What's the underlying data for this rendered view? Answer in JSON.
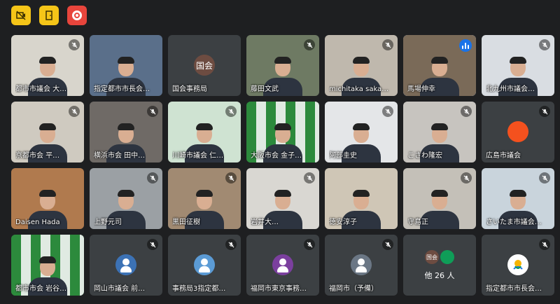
{
  "toolbar": {
    "buttons": [
      {
        "icon": "camera-off-icon",
        "style": "yellow"
      },
      {
        "icon": "door-exit-icon",
        "style": "yellow"
      },
      {
        "icon": "record-icon",
        "style": "red"
      }
    ]
  },
  "colors": {
    "background": "#1e1f21",
    "tile": "#3c4043",
    "active_outline": "#8ab4f8",
    "speaking": "#1a73e8",
    "yellow": "#f5c518",
    "red": "#e8453c"
  },
  "participants": [
    {
      "name": "都市市議会 大…",
      "kind": "video",
      "muted": true,
      "bg": "#d8d5cc"
    },
    {
      "name": "指定都市市長会…",
      "kind": "video",
      "muted": false,
      "bg": "#5a6f8a"
    },
    {
      "name": "国会事務局",
      "kind": "avatar",
      "muted": false,
      "initial": "国会",
      "avatar_color": "#6d4c41"
    },
    {
      "name": "藤田文武",
      "kind": "video",
      "muted": true,
      "bg": "#6e7a63"
    },
    {
      "name": "michitaka saka…",
      "kind": "video",
      "muted": true,
      "bg": "#bfb8ad"
    },
    {
      "name": "馬場伸幸",
      "kind": "video",
      "muted": false,
      "speaking": true,
      "active": true,
      "bg": "#7a6a58"
    },
    {
      "name": "北九州市議会…",
      "kind": "video",
      "muted": true,
      "bg": "#d9dde2"
    },
    {
      "name": "京都市会 平…",
      "kind": "video",
      "muted": true,
      "bg": "#cfcac0"
    },
    {
      "name": "横浜市会 田中…",
      "kind": "video",
      "muted": true,
      "bg": "#6f6a66"
    },
    {
      "name": "川崎市議会 仁…",
      "kind": "video",
      "muted": true,
      "bg": "#cfe3d2"
    },
    {
      "name": "大阪市会 金子…",
      "kind": "video",
      "muted": false,
      "bg": "#2d8a3c",
      "mosaic": true
    },
    {
      "name": "阿部圭史",
      "kind": "video",
      "muted": true,
      "bg": "#e4e6e8"
    },
    {
      "name": "こさわ隆宏",
      "kind": "video",
      "muted": true,
      "bg": "#c7c4bf"
    },
    {
      "name": "広島市議会",
      "kind": "avatar",
      "muted": true,
      "initial": "",
      "avatar_color": "#f4511e"
    },
    {
      "name": "Daisen Hada",
      "kind": "video",
      "muted": false,
      "bg": "#b07a4e"
    },
    {
      "name": "上野元司",
      "kind": "video",
      "muted": true,
      "bg": "#9ba0a4"
    },
    {
      "name": "黒田征樹",
      "kind": "video",
      "muted": true,
      "bg": "#a18a72"
    },
    {
      "name": "岩井大…",
      "kind": "video",
      "muted": true,
      "bg": "#d9d7d2"
    },
    {
      "name": "徳安淳子",
      "kind": "video",
      "muted": false,
      "bg": "#cfc6b6"
    },
    {
      "name": "守島正",
      "kind": "video",
      "muted": true,
      "bg": "#c4c0b8"
    },
    {
      "name": "さいたま市議会…",
      "kind": "video",
      "muted": true,
      "bg": "#c9d4dc"
    },
    {
      "name": "都市市会 岩谷…",
      "kind": "video",
      "muted": false,
      "bg": "#2d8a3c",
      "mosaic": true
    },
    {
      "name": "岡山市議会 前…",
      "kind": "avatar",
      "muted": true,
      "initial": "",
      "avatar_color": "#3c72b5",
      "person_icon": true
    },
    {
      "name": "事務局3指定都…",
      "kind": "avatar",
      "muted": true,
      "initial": "",
      "avatar_color": "#5b9bd5",
      "person_icon": true
    },
    {
      "name": "福岡市東京事務…",
      "kind": "avatar",
      "muted": true,
      "initial": "",
      "avatar_color": "#7b3f9e",
      "person_icon": true
    },
    {
      "name": "福岡市（予備）",
      "kind": "avatar",
      "muted": true,
      "initial": "",
      "avatar_color": "#6b7785",
      "person_icon": true
    },
    {
      "name": "",
      "kind": "others",
      "muted": false,
      "label": "他 26 人",
      "mini": [
        {
          "text": "国会",
          "color": "#6d4c41"
        },
        {
          "text": "",
          "color": "#0f9d58"
        }
      ]
    },
    {
      "name": "指定都市市長会…",
      "kind": "avatar",
      "muted": true,
      "initial": "",
      "avatar_color": "#ffffff",
      "logo": true
    }
  ]
}
